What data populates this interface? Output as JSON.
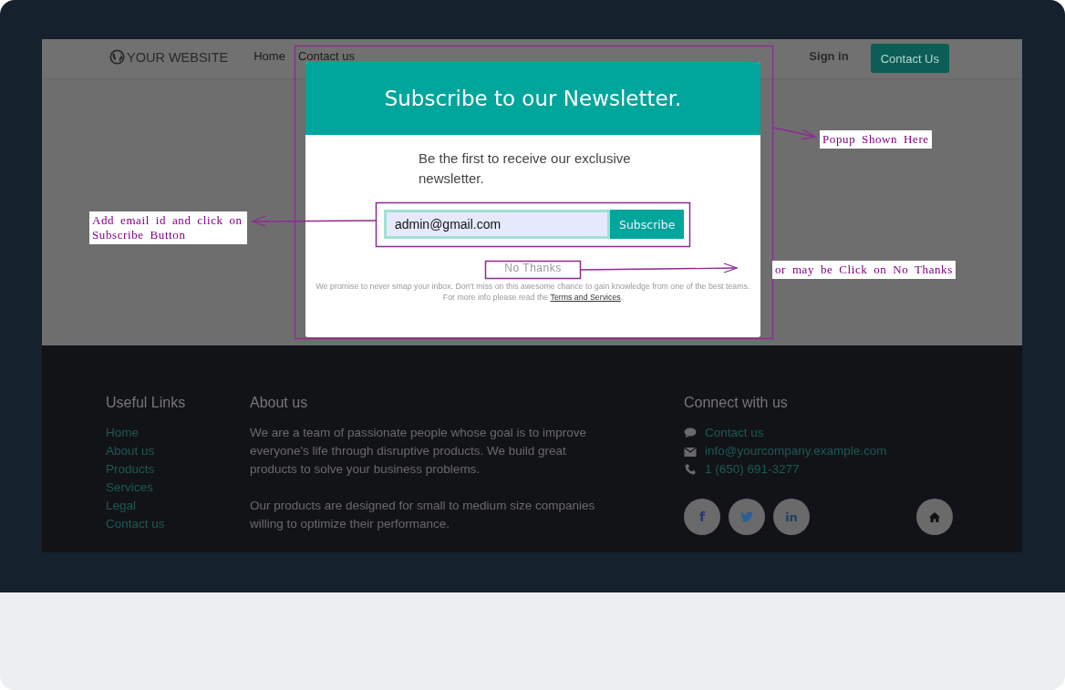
{
  "navbar": {
    "brand": "YOUR WEBSITE",
    "links": [
      {
        "label": "Home"
      },
      {
        "label": "Contact us"
      }
    ],
    "sign_in": "Sign in",
    "cta": "Contact Us"
  },
  "popup": {
    "title": "Subscribe to our Newsletter.",
    "intro": "Be the first to receive our exclusive newsletter.",
    "email": {
      "value": "admin@gmail.com"
    },
    "subscribe": "Subscribe",
    "decline": "No Thanks",
    "fine_print_before": "We promise to never smap your inbox. Don't miss on this awesome chance to gain knowledge from one of the best teams. For more info please read the",
    "terms_link": "Terms and Services",
    "fine_print_after": "."
  },
  "annotations": [
    {
      "kind": "popup",
      "text": "Popup Shown Here"
    },
    {
      "kind": "email",
      "text": "Add email id and click on Subscribe Button"
    },
    {
      "kind": "decline",
      "text": "or may be Click on No Thanks"
    }
  ],
  "footer": {
    "useful_links": {
      "heading": "Useful Links",
      "links": [
        "Home",
        "About us",
        "Products",
        "Services",
        "Legal",
        "Contact us"
      ]
    },
    "about": {
      "heading": "About us",
      "paragraphs": [
        "We are a team of passionate people whose goal is to improve everyone's life through disruptive products. We build great products to solve your business problems.",
        "Our products are designed for small to medium size companies willing to optimize their performance."
      ]
    },
    "connect": {
      "heading": "Connect with us",
      "items": [
        {
          "kind": "chat",
          "label": "Contact us"
        },
        {
          "kind": "mail",
          "label": "info@yourcompany.example.com"
        },
        {
          "kind": "phone",
          "label": "1 (650) 691-3277"
        }
      ],
      "social": [
        {
          "kind": "facebook",
          "glyph": "f"
        },
        {
          "kind": "twitter"
        },
        {
          "kind": "linkedin",
          "glyph": "in"
        }
      ],
      "home": {
        "kind": "home"
      }
    }
  }
}
